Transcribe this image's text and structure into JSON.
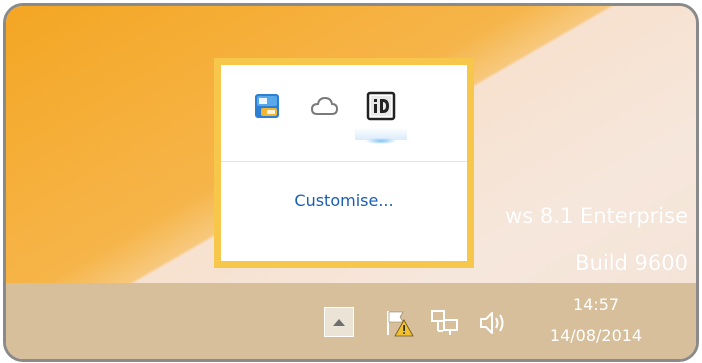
{
  "desktop": {
    "watermark_line1": "ws 8.1 Enterprise",
    "watermark_line2": "Build 9600"
  },
  "popup": {
    "icons": [
      {
        "icon": "app-blue-icon"
      },
      {
        "icon": "cloud-icon"
      },
      {
        "icon": "id-icon"
      }
    ],
    "customise_label": "Customise..."
  },
  "taskbar": {
    "icons": [
      "chevron-up-icon",
      "flag-warning-icon",
      "network-icon",
      "volume-icon"
    ],
    "clock_time": "14:57",
    "clock_date": "14/08/2014"
  },
  "colors": {
    "popup_border": "#f6c74b",
    "taskbar": "#d6bf9a",
    "link": "#1a5fb4",
    "desktop_accent": "#f4a623"
  }
}
